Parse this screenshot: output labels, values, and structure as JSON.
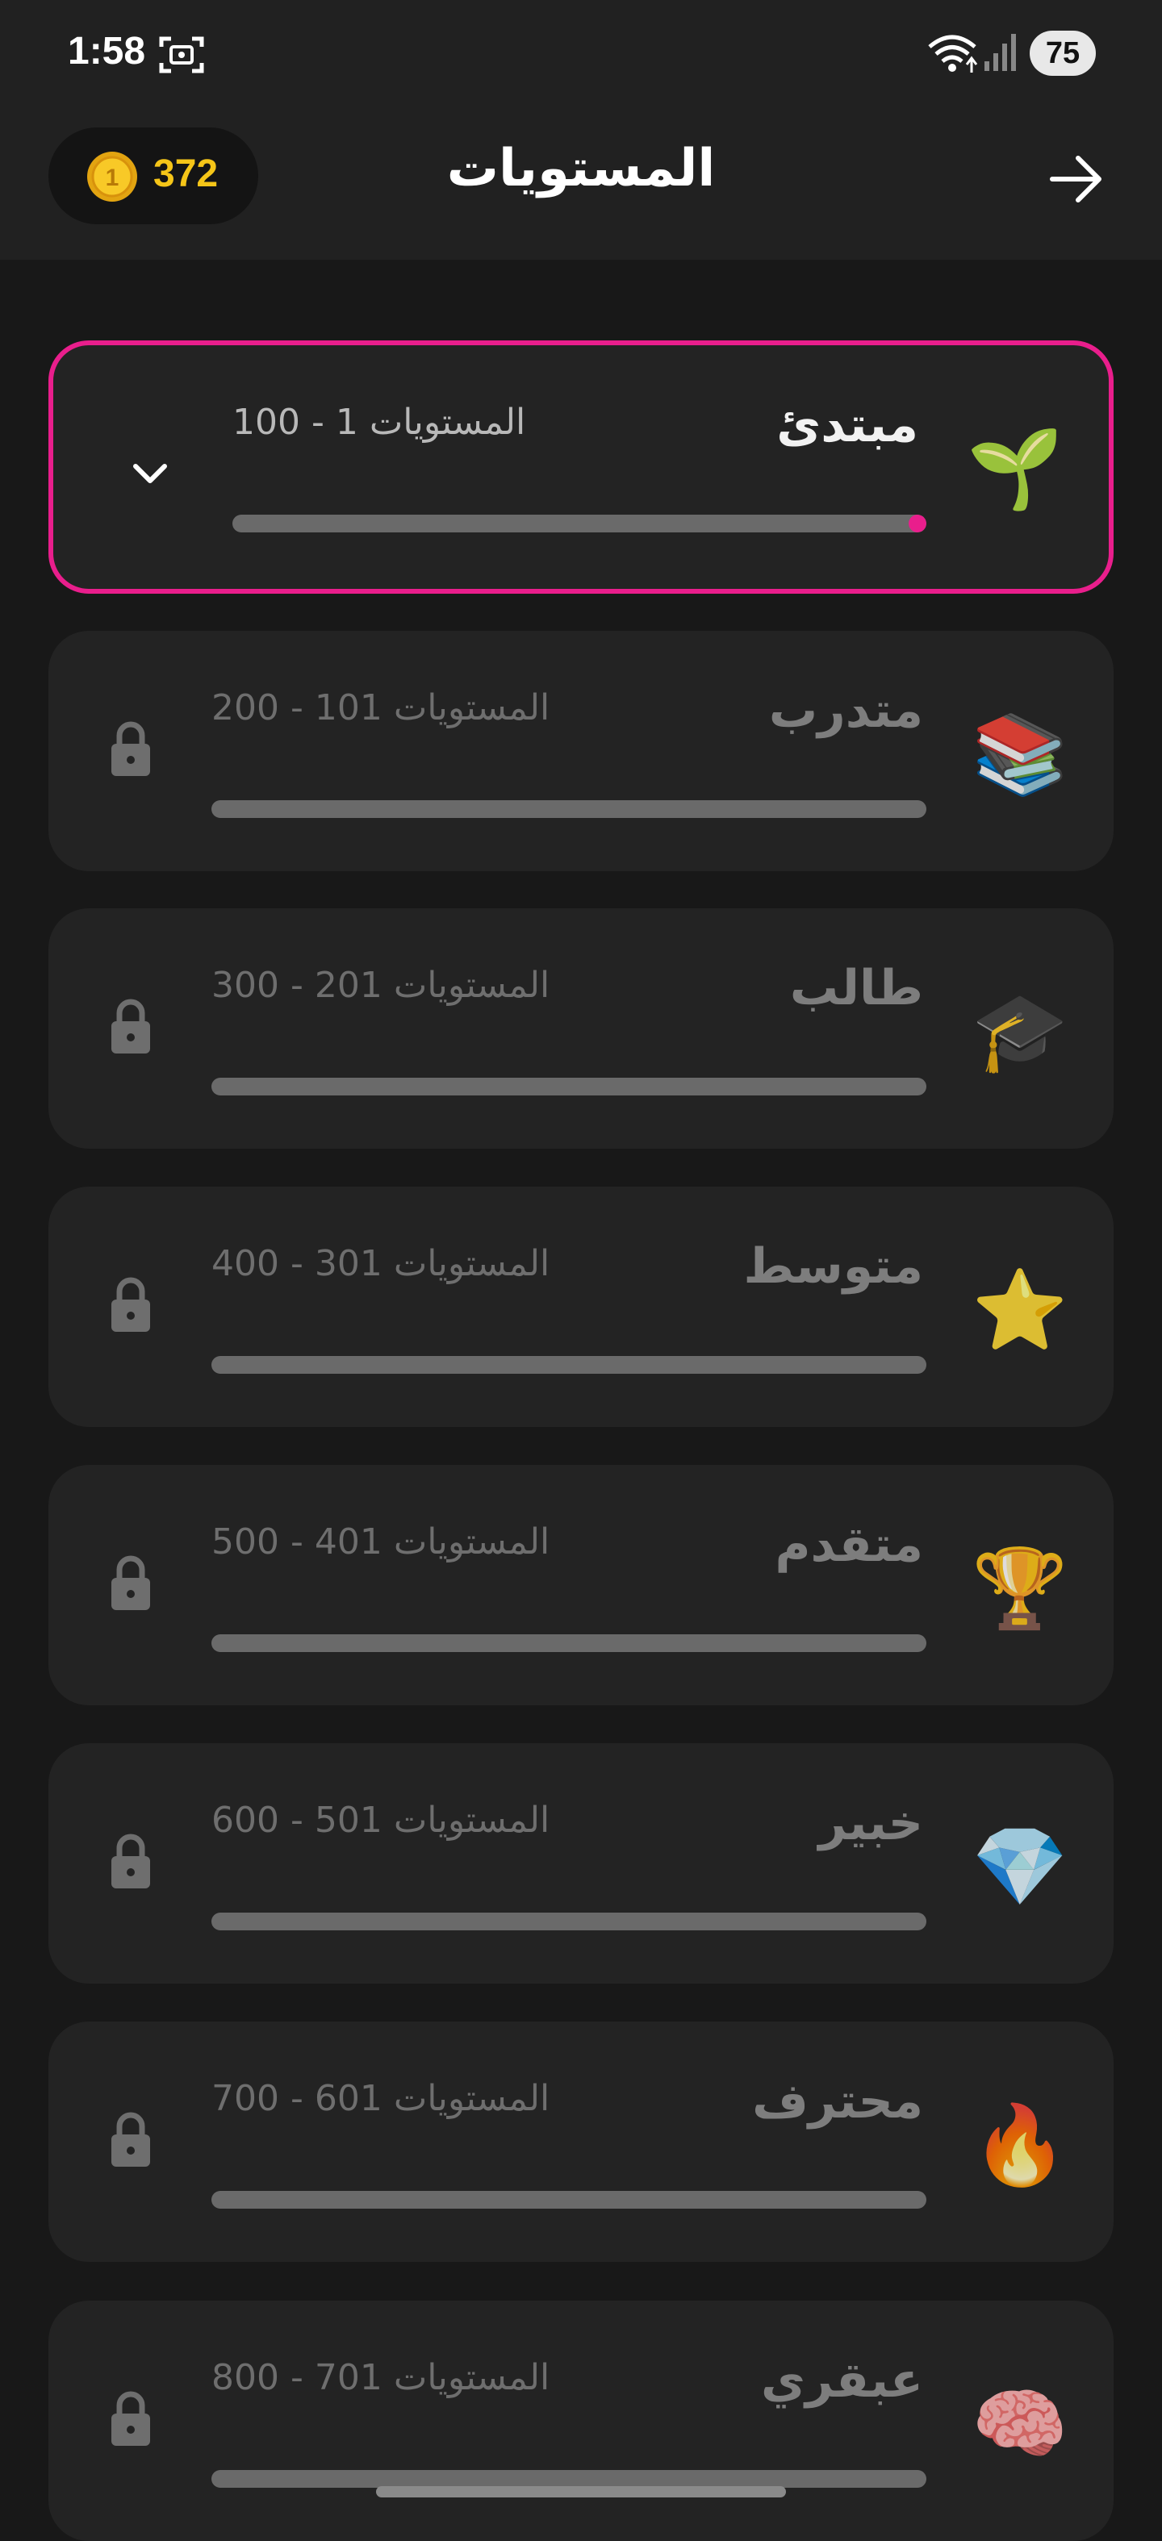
{
  "status_bar": {
    "time": "1:58",
    "battery": "75"
  },
  "header": {
    "title": "المستويات",
    "coins": "372"
  },
  "levels": [
    {
      "title": "مبتدئ",
      "range": "المستويات 1 - 100",
      "emoji": "🌱",
      "locked": false,
      "expanded": true,
      "progress": 0.02
    },
    {
      "title": "متدرب",
      "range": "المستويات 101 - 200",
      "emoji": "📚",
      "locked": true,
      "progress": 0
    },
    {
      "title": "طالب",
      "range": "المستويات 201 - 300",
      "emoji": "🎓",
      "locked": true,
      "progress": 0
    },
    {
      "title": "متوسط",
      "range": "المستويات 301 - 400",
      "emoji": "⭐",
      "locked": true,
      "progress": 0
    },
    {
      "title": "متقدم",
      "range": "المستويات 401 - 500",
      "emoji": "🏆",
      "locked": true,
      "progress": 0
    },
    {
      "title": "خبير",
      "range": "المستويات 501 - 600",
      "emoji": "💎",
      "locked": true,
      "progress": 0
    },
    {
      "title": "محترف",
      "range": "المستويات 601 - 700",
      "emoji": "🔥",
      "locked": true,
      "progress": 0
    },
    {
      "title": "عبقري",
      "range": "المستويات 701 - 800",
      "emoji": "🧠",
      "locked": true,
      "progress": 0
    }
  ],
  "colors": {
    "accent": "#e91e8c",
    "coin": "#f5c518",
    "background": "#181818",
    "card": "#232323"
  }
}
